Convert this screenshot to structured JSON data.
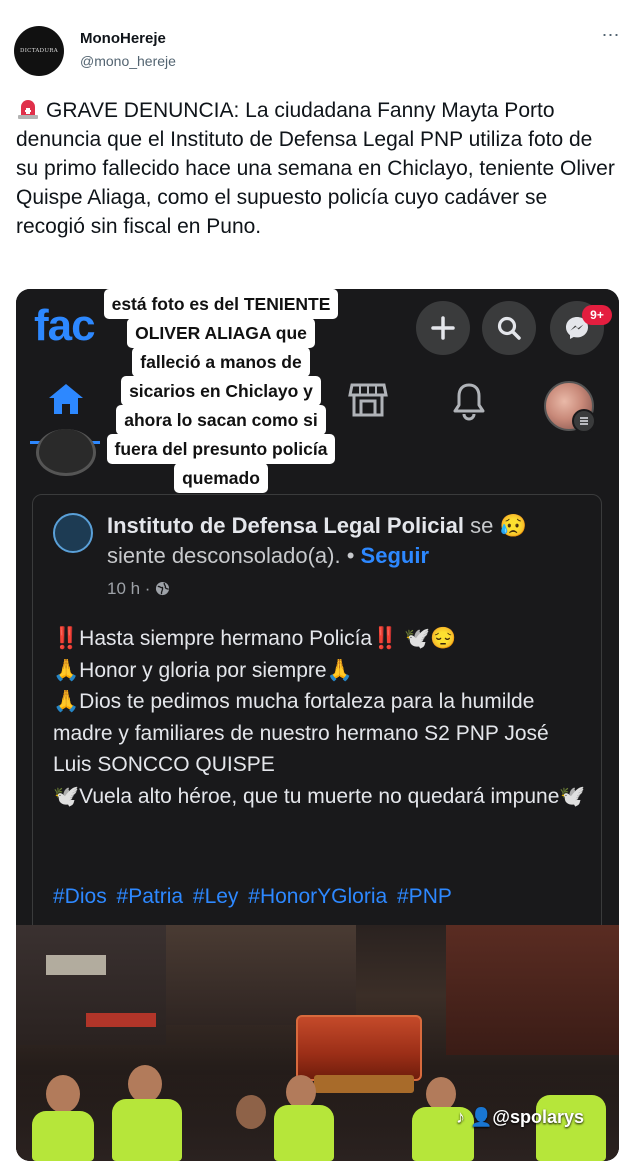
{
  "author": {
    "name": "MonoHereje",
    "handle": "@mono_hereje",
    "avatar_text": "DICTADURA"
  },
  "more_icon": "⋯",
  "tweet_text": "GRAVE DENUNCIA: La ciudadana Fanny Mayta Porto denuncia que el Instituto de Defensa Legal PNP utiliza foto de su primo fallecido hace una semana en Chiclayo, teniente Oliver Quispe Aliaga, como el supuesto policía cuyo cadáver se recogió sin fiscal en Puno.",
  "screenshot": {
    "fb_logo": "fac",
    "notif_badge": "9+",
    "caption_lines": [
      "está foto es del TENIENTE",
      "OLIVER ALIAGA que",
      "falleció a manos de",
      "sicarios en Chiclayo y",
      "ahora lo sacan como si",
      "fuera del presunto policía",
      "quemado"
    ],
    "post": {
      "page_name": "Instituto de Defensa Legal Policial",
      "feeling_prefix": "se",
      "feeling_emoji": "😥",
      "feeling_text": "siente desconsolado(a).",
      "separator": "•",
      "follow_label": "Seguir",
      "time": "10 h ·",
      "body_lines": [
        "‼️Hasta siempre hermano Policía‼️ 🕊️😔",
        "🙏Honor y gloria por siempre🙏",
        "🙏Dios te pedimos mucha fortaleza para la humilde madre y familiares de nuestro hermano S2 PNP José Luis SONCCO QUISPE",
        "🕊️Vuela alto héroe, que tu muerte no quedará impune🕊️"
      ],
      "hashtags": "#Dios #Patria #Ley #HonorYGloria #PNP"
    },
    "watermark": "♪ 👤@spolarys"
  },
  "colors": {
    "fb_blue": "#2d88ff",
    "fb_dark_bg": "#19191b",
    "badge_red": "#e41e3f",
    "text_dark": "#0f1419",
    "text_muted": "#536471"
  }
}
